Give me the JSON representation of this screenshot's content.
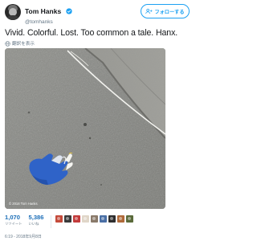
{
  "user": {
    "name": "Tom Hanks",
    "handle": "@tomhanks",
    "verified": true,
    "avatar_icon": "profile-photo"
  },
  "follow_button": {
    "label": "フォローする",
    "icon": "add-user-icon",
    "color": "#1da1f2"
  },
  "tweet": {
    "text": "Vivid. Colorful. Lost. Too common a tale. Hanx.",
    "translate_label": "翻訳を表示",
    "translate_icon": "globe-icon"
  },
  "photo": {
    "alt": "Blue and white work glove lying on gray asphalt next to a white painted line",
    "watermark": "© 2018 Tom Hanks"
  },
  "stats": {
    "retweets": {
      "count": "1,070",
      "label": "リツイート"
    },
    "likes": {
      "count": "5,386",
      "label": "いいね"
    }
  },
  "liker_avatars": [
    {
      "color": "#c44a3a"
    },
    {
      "color": "#3a3a3a"
    },
    {
      "color": "#c23b3b"
    },
    {
      "color": "#e0d6c8"
    },
    {
      "color": "#8a7a6a"
    },
    {
      "color": "#4a6fa5"
    },
    {
      "color": "#2e2e2e"
    },
    {
      "color": "#b06a3a"
    },
    {
      "color": "#5a6a3a"
    }
  ],
  "timestamp": "6:19 - 2018年9月8日",
  "colors": {
    "accent": "#1da1f2",
    "link_count": "#1d6fb8",
    "muted": "#657786"
  }
}
